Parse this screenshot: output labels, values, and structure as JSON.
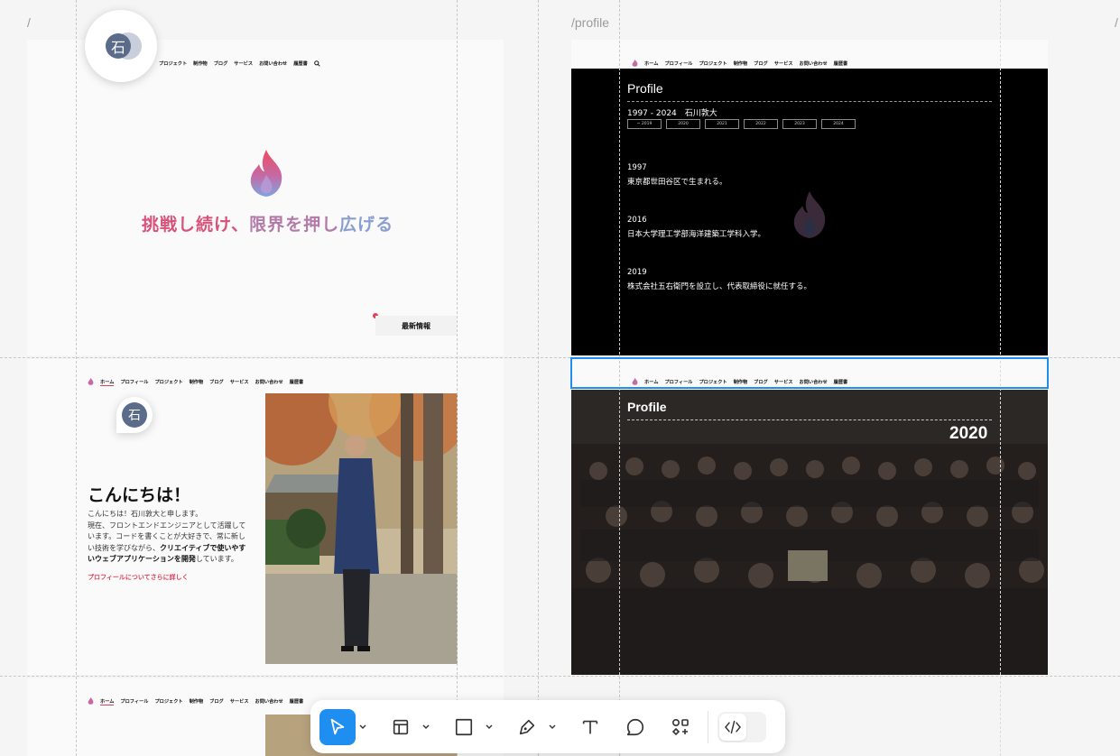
{
  "canvas": {
    "path_home": "/",
    "path_profile": "/profile",
    "path_third": "/"
  },
  "nav": {
    "items": [
      "ホーム",
      "プロフィール",
      "プロジェクト",
      "制作物",
      "ブログ",
      "サービス",
      "お問い合わせ",
      "履歴書"
    ]
  },
  "avatar": {
    "initial": "石"
  },
  "home_hero": {
    "title_part1": "挑戦し続け、",
    "title_part2": "限界を押し",
    "title_part3": "広げる",
    "news_label": "最新情報"
  },
  "greeting": {
    "title": "こんにちは！",
    "line1": "こんにちは！石川敦大と申します。",
    "line2": "現在、フロントエンドエンジニアとして活躍して",
    "line3": "います。コードを書くことが大好きで、常に新し",
    "line4_a": "い技術を学びながら、",
    "line4_b": "クリエイティブで使いやす",
    "line5_a": "いウェブアプリケーションを開発",
    "line5_b": "しています。",
    "link": "プロフィールについてさらに詳しく"
  },
  "profile": {
    "title": "Profile",
    "range": "1997 - 2024　石川敦大",
    "tabs": [
      "~ 2019",
      "2020",
      "2021",
      "2022",
      "2023",
      "2024"
    ],
    "timeline": [
      {
        "year": "1997",
        "text": "東京都世田谷区で生まれる。"
      },
      {
        "year": "2016",
        "text": "日本大学理工学部海洋建築工学科入学。"
      },
      {
        "year": "2019",
        "text": "株式会社五右衛門を設立し、代表取締役に就任する。"
      }
    ]
  },
  "profile2": {
    "title": "Profile",
    "year": "2020"
  },
  "colors": {
    "accent": "#e0405a",
    "selection": "#1f8ef1",
    "dark_bg": "#000000"
  },
  "toolbar": {
    "tools": [
      "move-tool",
      "frame-tool",
      "rectangle-tool",
      "pen-tool",
      "text-tool",
      "comment-tool",
      "components-tool",
      "dev-mode-toggle"
    ]
  }
}
